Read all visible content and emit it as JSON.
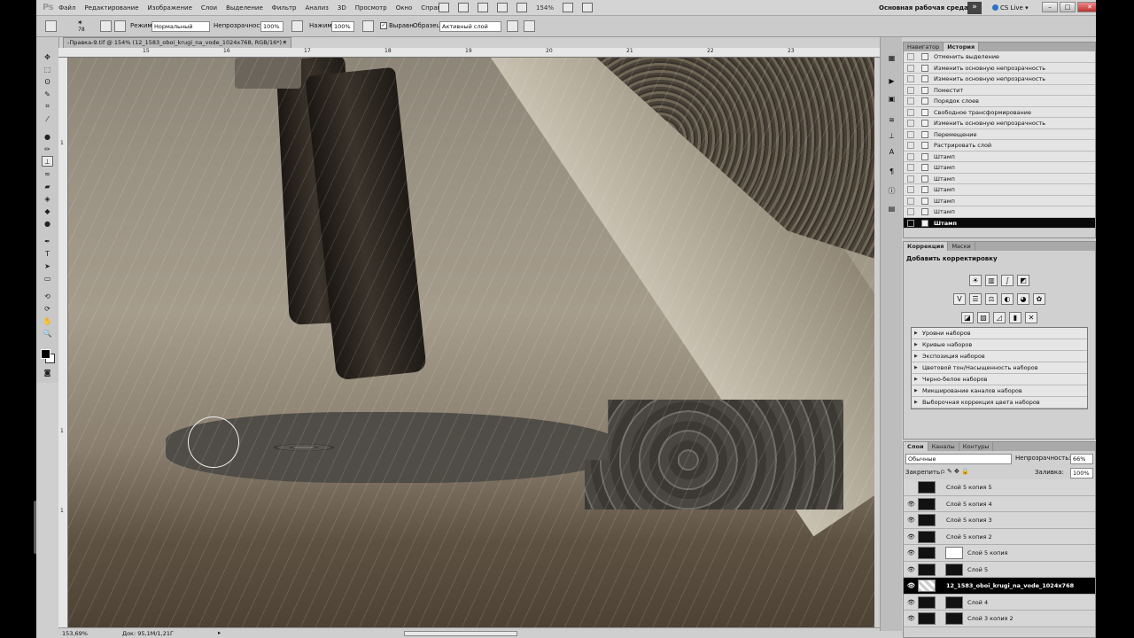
{
  "app": {
    "logo": "Ps"
  },
  "menu": [
    "Файл",
    "Редактирование",
    "Изображение",
    "Слои",
    "Выделение",
    "Фильтр",
    "Анализ",
    "3D",
    "Просмотр",
    "Окно",
    "Справка"
  ],
  "menubar": {
    "zoom": "154%",
    "workspace": "Основная рабочая среда",
    "cs_live": "CS Live"
  },
  "options": {
    "brush_size": "78",
    "mode_label": "Режим:",
    "mode_value": "Нормальный",
    "opacity_label": "Непрозрачность:",
    "opacity_value": "100%",
    "pressure_label": "Нажим:",
    "pressure_value": "100%",
    "aligned_label": "Выравн.",
    "sample_label": "Образец:",
    "sample_value": "Активный слой"
  },
  "document": {
    "tab_title": "-Правка-9.tif @ 154% (12_1583_oboi_krugi_na_vode_1024x768, RGB/16*) *",
    "close": "×"
  },
  "rulers": {
    "top": [
      "15",
      "16",
      "17",
      "18",
      "19",
      "20",
      "21",
      "22",
      "23"
    ],
    "left": [
      "1",
      "1",
      "1"
    ]
  },
  "history_panel": {
    "tabs": [
      "Навигатор",
      "История"
    ],
    "items": [
      "Отменить выделение",
      "Изменить основную непрозрачность",
      "Изменить основную непрозрачность",
      "Поместит",
      "Порядок слоев",
      "Свободное трансформирование",
      "Изменить основную непрозрачность",
      "Перемещение",
      "Растрировать слой",
      "Штамп",
      "Штамп",
      "Штамп",
      "Штамп",
      "Штамп",
      "Штамп",
      "Штамп"
    ],
    "selected_index": 15
  },
  "adjustments_panel": {
    "tabs": [
      "Коррекция",
      "Маски"
    ],
    "title": "Добавить корректировку",
    "presets": [
      "Уровни наборов",
      "Кривые наборов",
      "Экспозиция наборов",
      "Цветовой тон/Насыщенность наборов",
      "Черно-белое наборов",
      "Микширование каналов наборов",
      "Выборочная коррекция цвета наборов"
    ]
  },
  "layers_panel": {
    "tabs": [
      "Слои",
      "Каналы",
      "Контуры"
    ],
    "blend_mode": "Обычные",
    "opacity_label": "Непрозрачность:",
    "opacity_value": "66%",
    "lock_label": "Закрепить:",
    "fill_label": "Заливка:",
    "fill_value": "100%",
    "layers": [
      {
        "name": "Слой 5 копия 5",
        "visible": false
      },
      {
        "name": "Слой 5 копия 4",
        "visible": true
      },
      {
        "name": "Слой 5 копия 3",
        "visible": true
      },
      {
        "name": "Слой 5 копия 2",
        "visible": true
      },
      {
        "name": "Слой 5 копия",
        "visible": true
      },
      {
        "name": "Слой 5",
        "visible": true
      },
      {
        "name": "12_1583_oboi_krugi_na_vode_1024x768",
        "visible": true
      },
      {
        "name": "Слой 4",
        "visible": true
      },
      {
        "name": "Слой 3 копия 2",
        "visible": true
      }
    ],
    "selected_index": 6
  },
  "status": {
    "zoom": "153,69%",
    "doc": "Док: 95,1M/1,21Г"
  },
  "colors": {
    "selected_row": "#000000",
    "accent": "#2a72c4"
  }
}
